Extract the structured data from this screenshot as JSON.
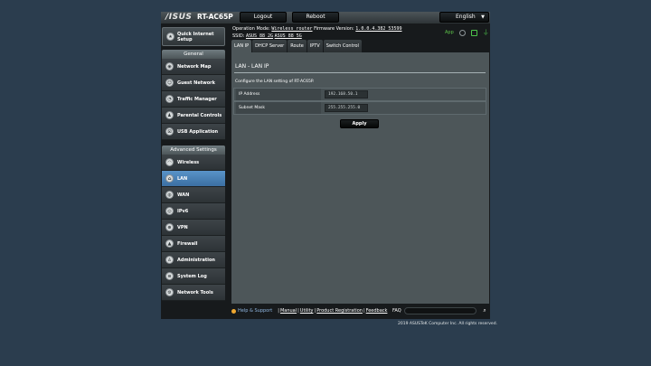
{
  "header": {
    "brand": "/ISUS",
    "model": "RT-AC65P",
    "logout_label": "Logout",
    "reboot_label": "Reboot",
    "language": "English"
  },
  "status": {
    "operation_mode_label": "Operation Mode:",
    "operation_mode": "Wireless router",
    "firmware_label": "Firmware Version:",
    "firmware": "1.0.0.4.382_53599",
    "ssid_label": "SSID:",
    "ssid_24": "ASUS_88_2G",
    "ssid_5": "ASUS_88_5G",
    "app_label": "App"
  },
  "sidebar": {
    "qis_label_1": "Quick Internet",
    "qis_label_2": "Setup",
    "general_header": "General",
    "general_items": [
      {
        "label": "Network Map"
      },
      {
        "label": "Guest Network"
      },
      {
        "label": "Traffic Manager"
      },
      {
        "label": "Parental Controls"
      },
      {
        "label": "USB Application"
      }
    ],
    "advanced_header": "Advanced Settings",
    "advanced_items": [
      {
        "label": "Wireless"
      },
      {
        "label": "LAN"
      },
      {
        "label": "WAN"
      },
      {
        "label": "IPv6"
      },
      {
        "label": "VPN"
      },
      {
        "label": "Firewall"
      },
      {
        "label": "Administration"
      },
      {
        "label": "System Log"
      },
      {
        "label": "Network Tools"
      }
    ]
  },
  "tabs": [
    "LAN IP",
    "DHCP Server",
    "Route",
    "IPTV",
    "Switch Control"
  ],
  "main": {
    "title": "LAN - LAN IP",
    "description": "Configure the LAN setting of RT-AC65P.",
    "rows": [
      {
        "label": "IP Address",
        "value": "192.168.50.1"
      },
      {
        "label": "Subnet Mask",
        "value": "255.255.255.0"
      }
    ],
    "apply_label": "Apply"
  },
  "footer": {
    "help": "Help & Support",
    "manual": "Manual",
    "utility": "Utility",
    "registration": "Product Registration",
    "feedback": "Feedback",
    "faq": "FAQ",
    "copyright": "2019 ASUSTeK Computer Inc. All rights reserved."
  }
}
